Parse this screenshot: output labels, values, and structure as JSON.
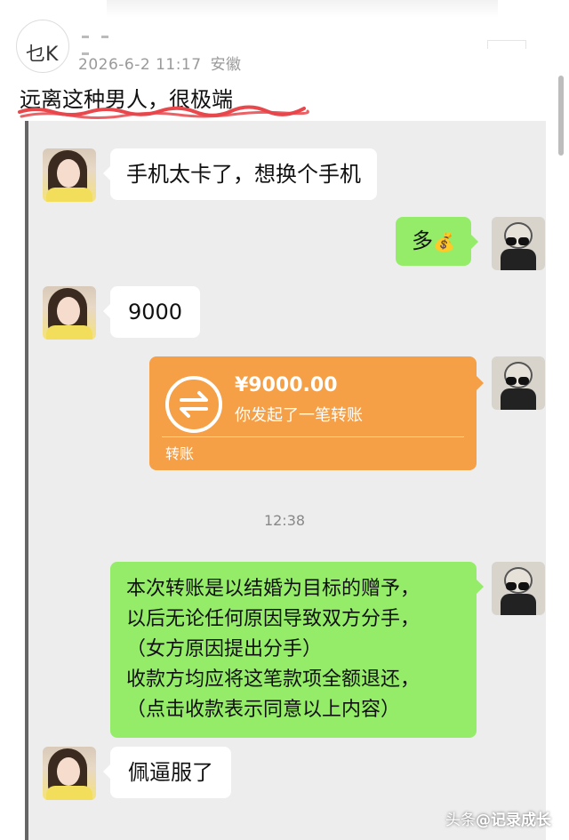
{
  "post": {
    "date": "2026-6-2 11:17",
    "location": "安徽",
    "headline": "远离这种男人，很极端",
    "avatar_text": "乜K"
  },
  "chat": {
    "messages": [
      {
        "side": "left",
        "text": "手机太卡了，想换个手机"
      },
      {
        "side": "right",
        "text": "多",
        "emoji": "💰"
      },
      {
        "side": "left",
        "text": "9000"
      },
      {
        "side": "left",
        "text": "佩逼服了"
      }
    ],
    "transfer": {
      "amount": "¥9000.00",
      "note": "你发起了一笔转账",
      "label": "转账",
      "icon": "transfer-arrows-icon"
    },
    "timestamp": "12:38",
    "long_message": [
      "本次转账是以结婚为目标的赠予，",
      "以后无论任何原因导致双方分手，",
      "（女方原因提出分手）",
      "收款方均应将这笔款项全额退还，",
      "（点击收款表示同意以上内容）"
    ]
  },
  "watermark": {
    "prefix": "头条",
    "handle": "@记录成长"
  },
  "colors": {
    "chat_bg": "#ededed",
    "green_bubble": "#95ec69",
    "transfer_orange": "#f59f46",
    "underline_red": "#e8474b"
  }
}
